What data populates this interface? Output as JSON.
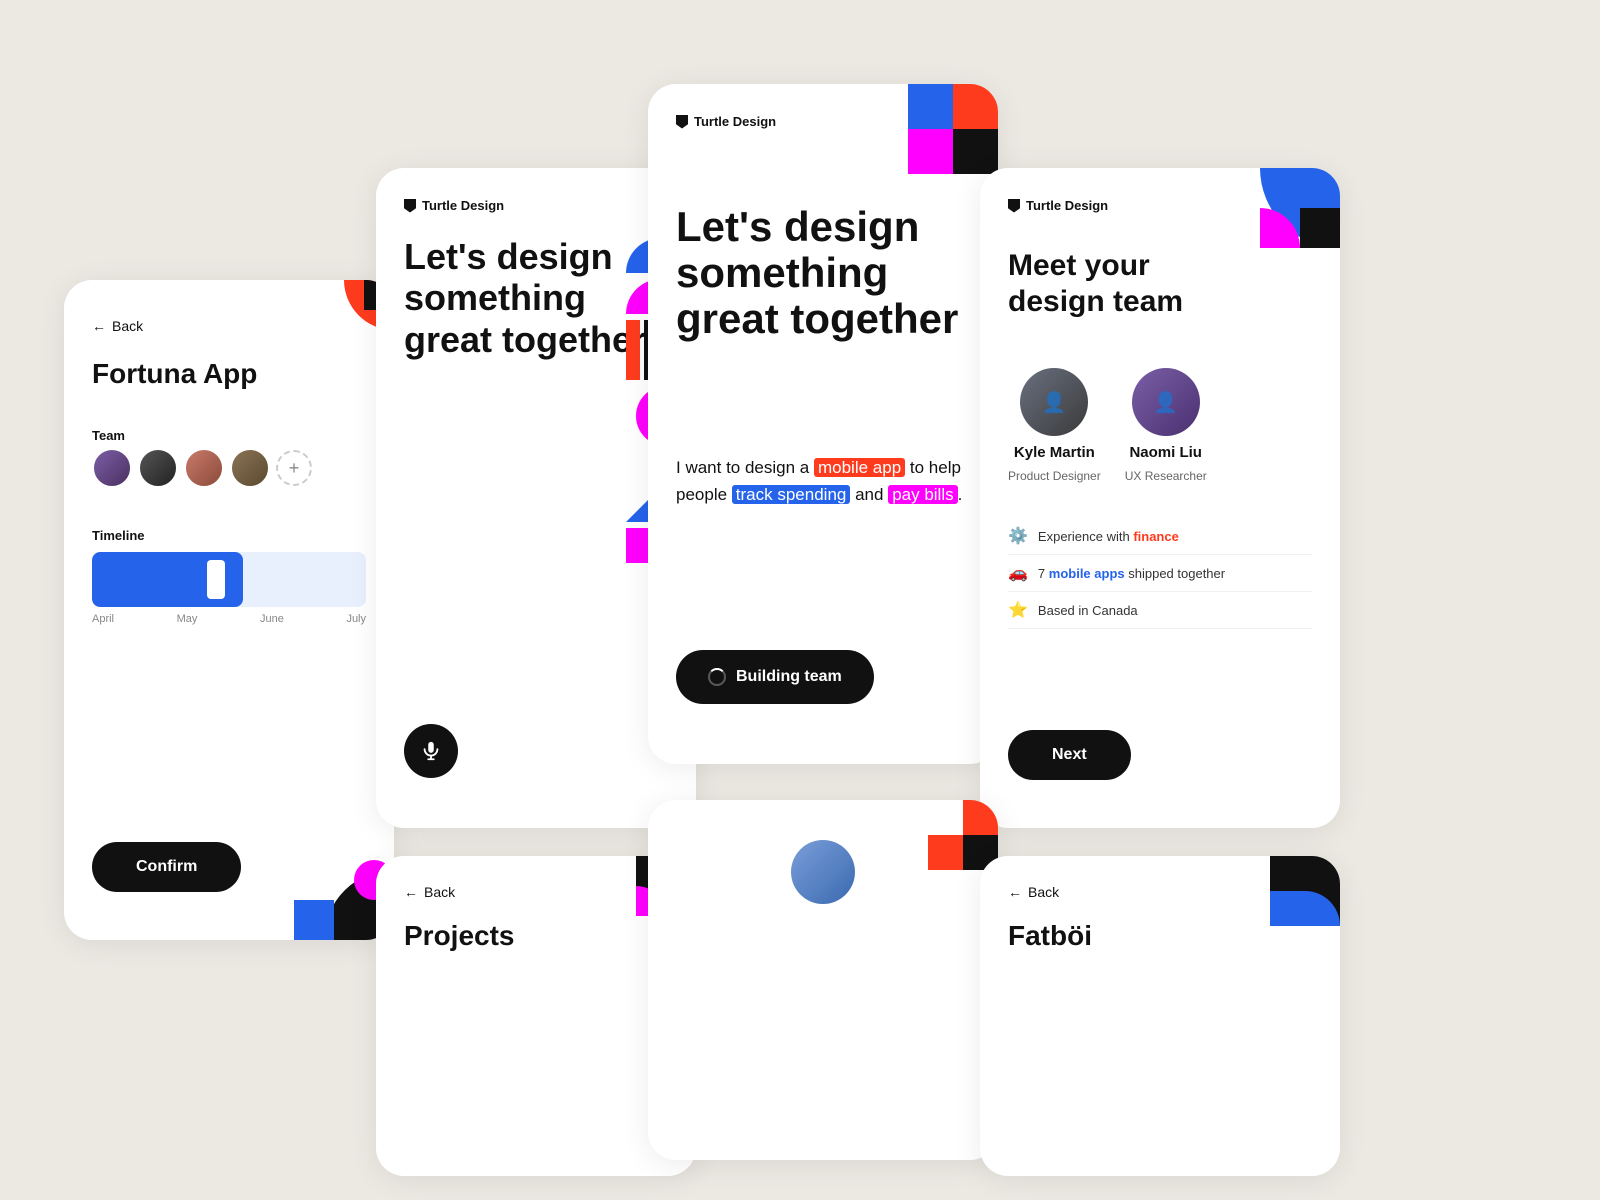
{
  "cards": {
    "fortuna": {
      "back_label": "Back",
      "title": "Fortuna App",
      "team_label": "Team",
      "timeline_label": "Timeline",
      "months": [
        "April",
        "May",
        "June",
        "July"
      ],
      "confirm_label": "Confirm"
    },
    "design_left": {
      "logo": "Turtle Design",
      "main_text": "Let's design something great together"
    },
    "design_center": {
      "logo": "Turtle Design",
      "main_text": "Let's design something great together",
      "body_pre": "I want to design a",
      "highlight1": "mobile app",
      "body_mid": "to help people",
      "highlight2": "track spending",
      "body_mid2": "and",
      "highlight3": "pay bills",
      "body_end": ".",
      "building_label": "Building team"
    },
    "team": {
      "logo": "Turtle Design",
      "meet_text": "Meet your\ndesign team",
      "members": [
        {
          "name": "Kyle Martin",
          "role": "Product Designer"
        },
        {
          "name": "Naomi Liu",
          "role": "UX Researcher"
        }
      ],
      "tags": [
        {
          "icon": "⚙️",
          "pre": "Experience with",
          "link": "finance",
          "link_color": "orange"
        },
        {
          "icon": "🚗",
          "pre": "7",
          "link": "mobile apps",
          "link_color": "blue",
          "post": " shipped together"
        },
        {
          "icon": "⭐",
          "text": "Based in Canada"
        }
      ],
      "next_label": "Next"
    },
    "projects": {
      "back_label": "Back",
      "title": "Projects"
    },
    "fatboi": {
      "back_label": "Back",
      "title": "Fatböi"
    }
  }
}
